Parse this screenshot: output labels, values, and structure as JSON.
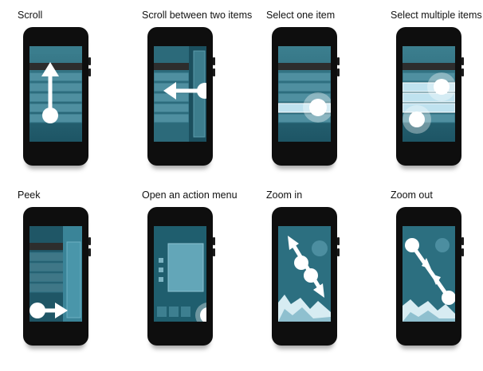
{
  "gestures": {
    "scroll": "Scroll",
    "scroll_between": "Scroll between two items",
    "select_one": "Select one item",
    "select_multiple": "Select multiple items",
    "peek": "Peek",
    "action_menu": "Open an action menu",
    "zoom_in": "Zoom in",
    "zoom_out": "Zoom out"
  },
  "colors": {
    "screen_top": "#3c7f8f",
    "screen_bottom": "#1d5565",
    "list_row": "#4f8fa0",
    "list_row_dark": "#2d2d2d",
    "selected_row": "#bfe2ef",
    "phone_body": "#0e0e0e",
    "gesture": "#ffffff"
  }
}
